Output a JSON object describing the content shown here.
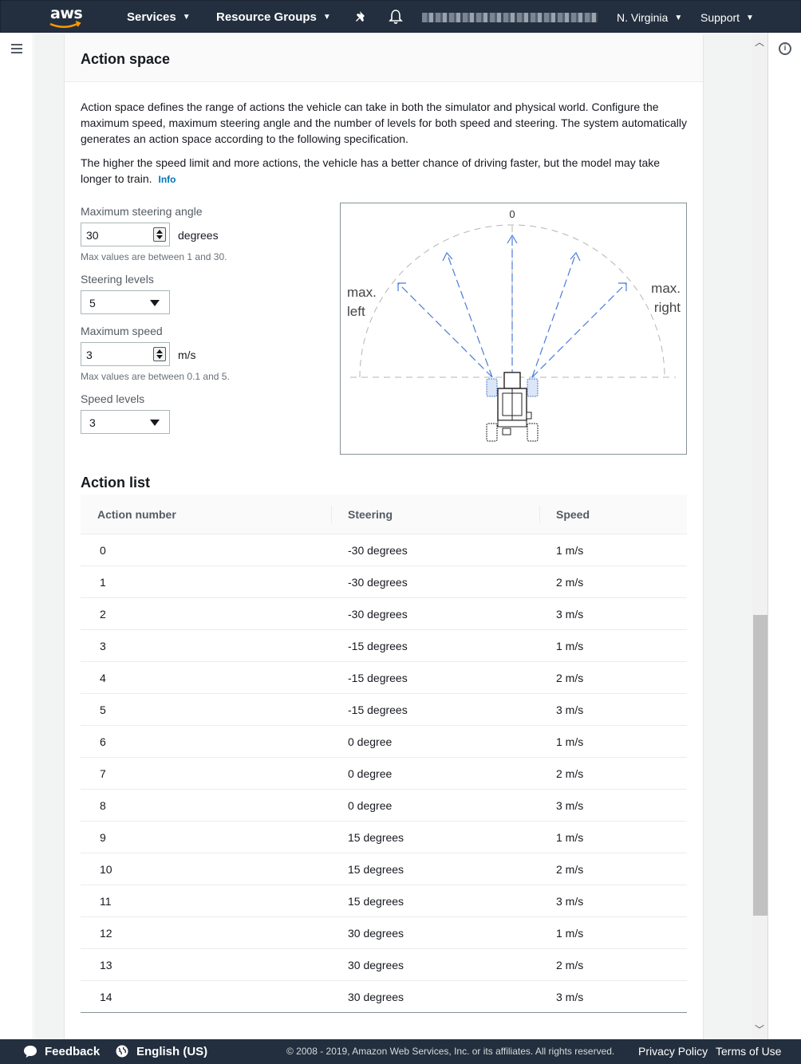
{
  "header": {
    "logo": "aws",
    "services": "Services",
    "resource_groups": "Resource Groups",
    "region": "N. Virginia",
    "support": "Support"
  },
  "panel": {
    "title": "Action space",
    "desc1": "Action space defines the range of actions the vehicle can take in both the simulator and physical world. Configure the maximum speed, maximum steering angle and the number of levels for both speed and steering. The system automatically generates an action space according to the following specification.",
    "desc2": "The higher the speed limit and more actions, the vehicle has a better chance of driving faster, but the model may take longer to train.",
    "info": "Info"
  },
  "form": {
    "max_steering_label": "Maximum steering angle",
    "max_steering_value": "30",
    "max_steering_unit": "degrees",
    "max_steering_hint": "Max values are between 1 and 30.",
    "steering_levels_label": "Steering levels",
    "steering_levels_value": "5",
    "max_speed_label": "Maximum speed",
    "max_speed_value": "3",
    "max_speed_unit": "m/s",
    "max_speed_hint": "Max values are between 0.1 and 5.",
    "speed_levels_label": "Speed levels",
    "speed_levels_value": "3"
  },
  "diagram": {
    "zero": "0",
    "max_left_1": "max.",
    "max_left_2": "left",
    "max_right_1": "max.",
    "max_right_2": "right",
    "arrow_color": "#4a7bd8"
  },
  "action_list": {
    "title": "Action list",
    "columns": [
      "Action number",
      "Steering",
      "Speed"
    ],
    "rows": [
      [
        "0",
        "-30 degrees",
        "1 m/s"
      ],
      [
        "1",
        "-30 degrees",
        "2 m/s"
      ],
      [
        "2",
        "-30 degrees",
        "3 m/s"
      ],
      [
        "3",
        "-15 degrees",
        "1 m/s"
      ],
      [
        "4",
        "-15 degrees",
        "2 m/s"
      ],
      [
        "5",
        "-15 degrees",
        "3 m/s"
      ],
      [
        "6",
        "0 degree",
        "1 m/s"
      ],
      [
        "7",
        "0 degree",
        "2 m/s"
      ],
      [
        "8",
        "0 degree",
        "3 m/s"
      ],
      [
        "9",
        "15 degrees",
        "1 m/s"
      ],
      [
        "10",
        "15 degrees",
        "2 m/s"
      ],
      [
        "11",
        "15 degrees",
        "3 m/s"
      ],
      [
        "12",
        "30 degrees",
        "1 m/s"
      ],
      [
        "13",
        "30 degrees",
        "2 m/s"
      ],
      [
        "14",
        "30 degrees",
        "3 m/s"
      ]
    ]
  },
  "footer": {
    "feedback": "Feedback",
    "language": "English (US)",
    "copyright": "© 2008 - 2019, Amazon Web Services, Inc. or its affiliates. All rights reserved.",
    "privacy": "Privacy Policy",
    "terms": "Terms of Use"
  },
  "colors": {
    "nav_bg": "#232f3e",
    "link": "#0073bb",
    "page_bg": "#f2f3f3"
  }
}
